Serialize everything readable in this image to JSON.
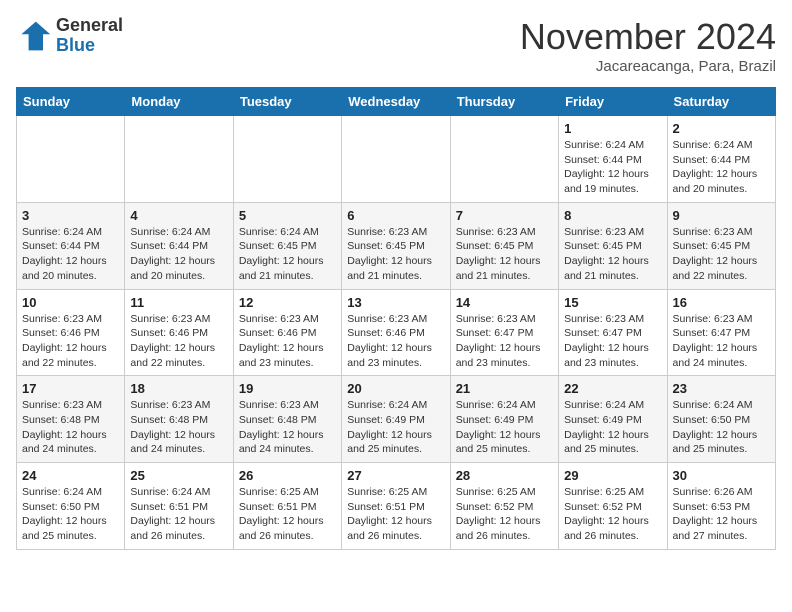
{
  "header": {
    "logo_general": "General",
    "logo_blue": "Blue",
    "month_title": "November 2024",
    "subtitle": "Jacareacanga, Para, Brazil"
  },
  "days_of_week": [
    "Sunday",
    "Monday",
    "Tuesday",
    "Wednesday",
    "Thursday",
    "Friday",
    "Saturday"
  ],
  "weeks": [
    [
      {
        "day": "",
        "info": ""
      },
      {
        "day": "",
        "info": ""
      },
      {
        "day": "",
        "info": ""
      },
      {
        "day": "",
        "info": ""
      },
      {
        "day": "",
        "info": ""
      },
      {
        "day": "1",
        "info": "Sunrise: 6:24 AM\nSunset: 6:44 PM\nDaylight: 12 hours and 19 minutes."
      },
      {
        "day": "2",
        "info": "Sunrise: 6:24 AM\nSunset: 6:44 PM\nDaylight: 12 hours and 20 minutes."
      }
    ],
    [
      {
        "day": "3",
        "info": "Sunrise: 6:24 AM\nSunset: 6:44 PM\nDaylight: 12 hours and 20 minutes."
      },
      {
        "day": "4",
        "info": "Sunrise: 6:24 AM\nSunset: 6:44 PM\nDaylight: 12 hours and 20 minutes."
      },
      {
        "day": "5",
        "info": "Sunrise: 6:24 AM\nSunset: 6:45 PM\nDaylight: 12 hours and 21 minutes."
      },
      {
        "day": "6",
        "info": "Sunrise: 6:23 AM\nSunset: 6:45 PM\nDaylight: 12 hours and 21 minutes."
      },
      {
        "day": "7",
        "info": "Sunrise: 6:23 AM\nSunset: 6:45 PM\nDaylight: 12 hours and 21 minutes."
      },
      {
        "day": "8",
        "info": "Sunrise: 6:23 AM\nSunset: 6:45 PM\nDaylight: 12 hours and 21 minutes."
      },
      {
        "day": "9",
        "info": "Sunrise: 6:23 AM\nSunset: 6:45 PM\nDaylight: 12 hours and 22 minutes."
      }
    ],
    [
      {
        "day": "10",
        "info": "Sunrise: 6:23 AM\nSunset: 6:46 PM\nDaylight: 12 hours and 22 minutes."
      },
      {
        "day": "11",
        "info": "Sunrise: 6:23 AM\nSunset: 6:46 PM\nDaylight: 12 hours and 22 minutes."
      },
      {
        "day": "12",
        "info": "Sunrise: 6:23 AM\nSunset: 6:46 PM\nDaylight: 12 hours and 23 minutes."
      },
      {
        "day": "13",
        "info": "Sunrise: 6:23 AM\nSunset: 6:46 PM\nDaylight: 12 hours and 23 minutes."
      },
      {
        "day": "14",
        "info": "Sunrise: 6:23 AM\nSunset: 6:47 PM\nDaylight: 12 hours and 23 minutes."
      },
      {
        "day": "15",
        "info": "Sunrise: 6:23 AM\nSunset: 6:47 PM\nDaylight: 12 hours and 23 minutes."
      },
      {
        "day": "16",
        "info": "Sunrise: 6:23 AM\nSunset: 6:47 PM\nDaylight: 12 hours and 24 minutes."
      }
    ],
    [
      {
        "day": "17",
        "info": "Sunrise: 6:23 AM\nSunset: 6:48 PM\nDaylight: 12 hours and 24 minutes."
      },
      {
        "day": "18",
        "info": "Sunrise: 6:23 AM\nSunset: 6:48 PM\nDaylight: 12 hours and 24 minutes."
      },
      {
        "day": "19",
        "info": "Sunrise: 6:23 AM\nSunset: 6:48 PM\nDaylight: 12 hours and 24 minutes."
      },
      {
        "day": "20",
        "info": "Sunrise: 6:24 AM\nSunset: 6:49 PM\nDaylight: 12 hours and 25 minutes."
      },
      {
        "day": "21",
        "info": "Sunrise: 6:24 AM\nSunset: 6:49 PM\nDaylight: 12 hours and 25 minutes."
      },
      {
        "day": "22",
        "info": "Sunrise: 6:24 AM\nSunset: 6:49 PM\nDaylight: 12 hours and 25 minutes."
      },
      {
        "day": "23",
        "info": "Sunrise: 6:24 AM\nSunset: 6:50 PM\nDaylight: 12 hours and 25 minutes."
      }
    ],
    [
      {
        "day": "24",
        "info": "Sunrise: 6:24 AM\nSunset: 6:50 PM\nDaylight: 12 hours and 25 minutes."
      },
      {
        "day": "25",
        "info": "Sunrise: 6:24 AM\nSunset: 6:51 PM\nDaylight: 12 hours and 26 minutes."
      },
      {
        "day": "26",
        "info": "Sunrise: 6:25 AM\nSunset: 6:51 PM\nDaylight: 12 hours and 26 minutes."
      },
      {
        "day": "27",
        "info": "Sunrise: 6:25 AM\nSunset: 6:51 PM\nDaylight: 12 hours and 26 minutes."
      },
      {
        "day": "28",
        "info": "Sunrise: 6:25 AM\nSunset: 6:52 PM\nDaylight: 12 hours and 26 minutes."
      },
      {
        "day": "29",
        "info": "Sunrise: 6:25 AM\nSunset: 6:52 PM\nDaylight: 12 hours and 26 minutes."
      },
      {
        "day": "30",
        "info": "Sunrise: 6:26 AM\nSunset: 6:53 PM\nDaylight: 12 hours and 27 minutes."
      }
    ]
  ]
}
